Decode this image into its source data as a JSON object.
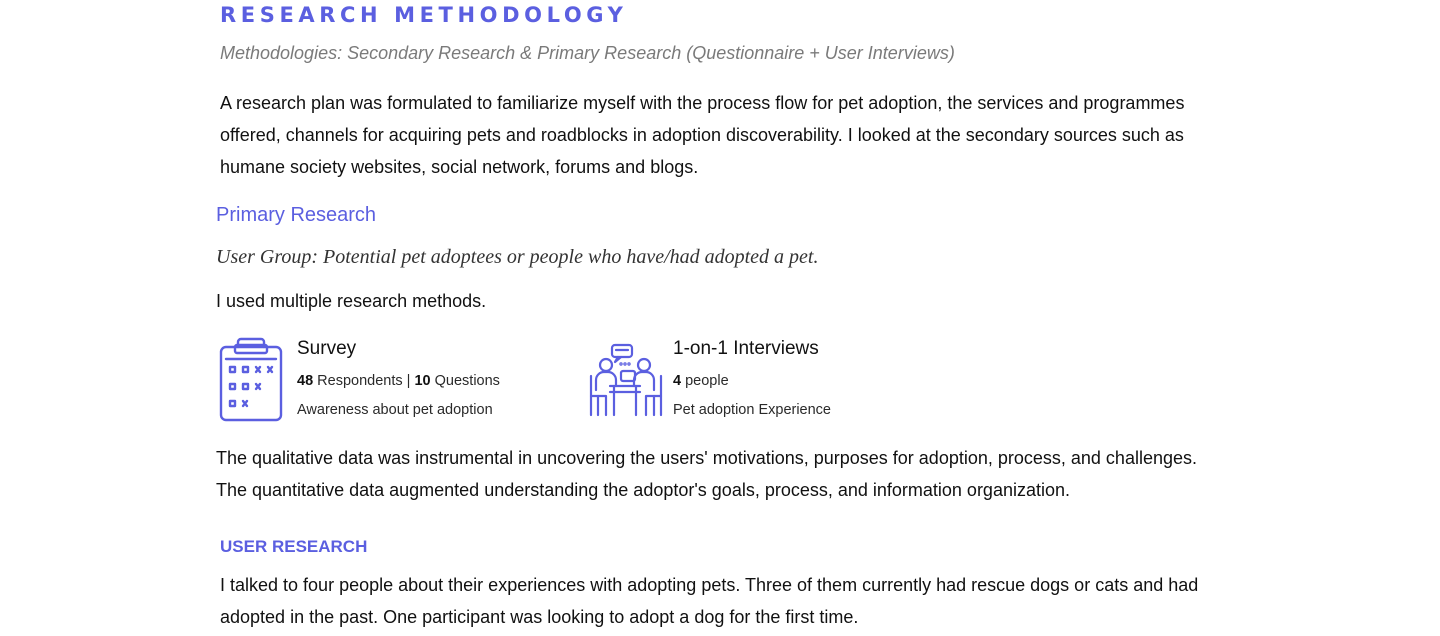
{
  "methodology": {
    "title": "RESEARCH METHODOLOGY",
    "subtitle": "Methodologies: Secondary Research & Primary Research (Questionnaire + User Interviews)",
    "paragraph": "A research plan was formulated to familiarize myself with the process flow for pet adoption, the services and programmes offered, channels for acquiring pets and roadblocks in adoption discoverability. I looked at the secondary sources such as humane society websites, social network, forums and blogs."
  },
  "primary": {
    "heading": "Primary Research",
    "user_group": "User Group: Potential pet adoptees or people who have/had adopted a pet.",
    "intro": "I used multiple research methods."
  },
  "methods": {
    "survey": {
      "icon": "clipboard-icon",
      "title": "Survey",
      "respondents_count": "48",
      "respondents_label": "Respondents",
      "separator": "|",
      "questions_count": "10",
      "questions_label": "Questions",
      "description": "Awareness about pet adoption"
    },
    "interviews": {
      "icon": "interview-icon",
      "title": "1-on-1 Interviews",
      "people_count": "4",
      "people_label": "people",
      "description": "Pet adoption Experience"
    }
  },
  "summary": {
    "line1": "The qualitative data was instrumental in uncovering the users' motivations, purposes for adoption, process, and challenges.",
    "line2": "The quantitative data augmented understanding the adoptor's goals, process, and information organization."
  },
  "user_research": {
    "heading": "USER RESEARCH",
    "paragraph": "I talked to four people about their experiences with adopting pets. Three of them currently had rescue dogs or cats and had adopted in the past. One participant was looking to adopt a dog for the first time."
  },
  "colors": {
    "accent": "#5b5fe0",
    "text": "#111111",
    "muted": "#7a7a7a"
  }
}
